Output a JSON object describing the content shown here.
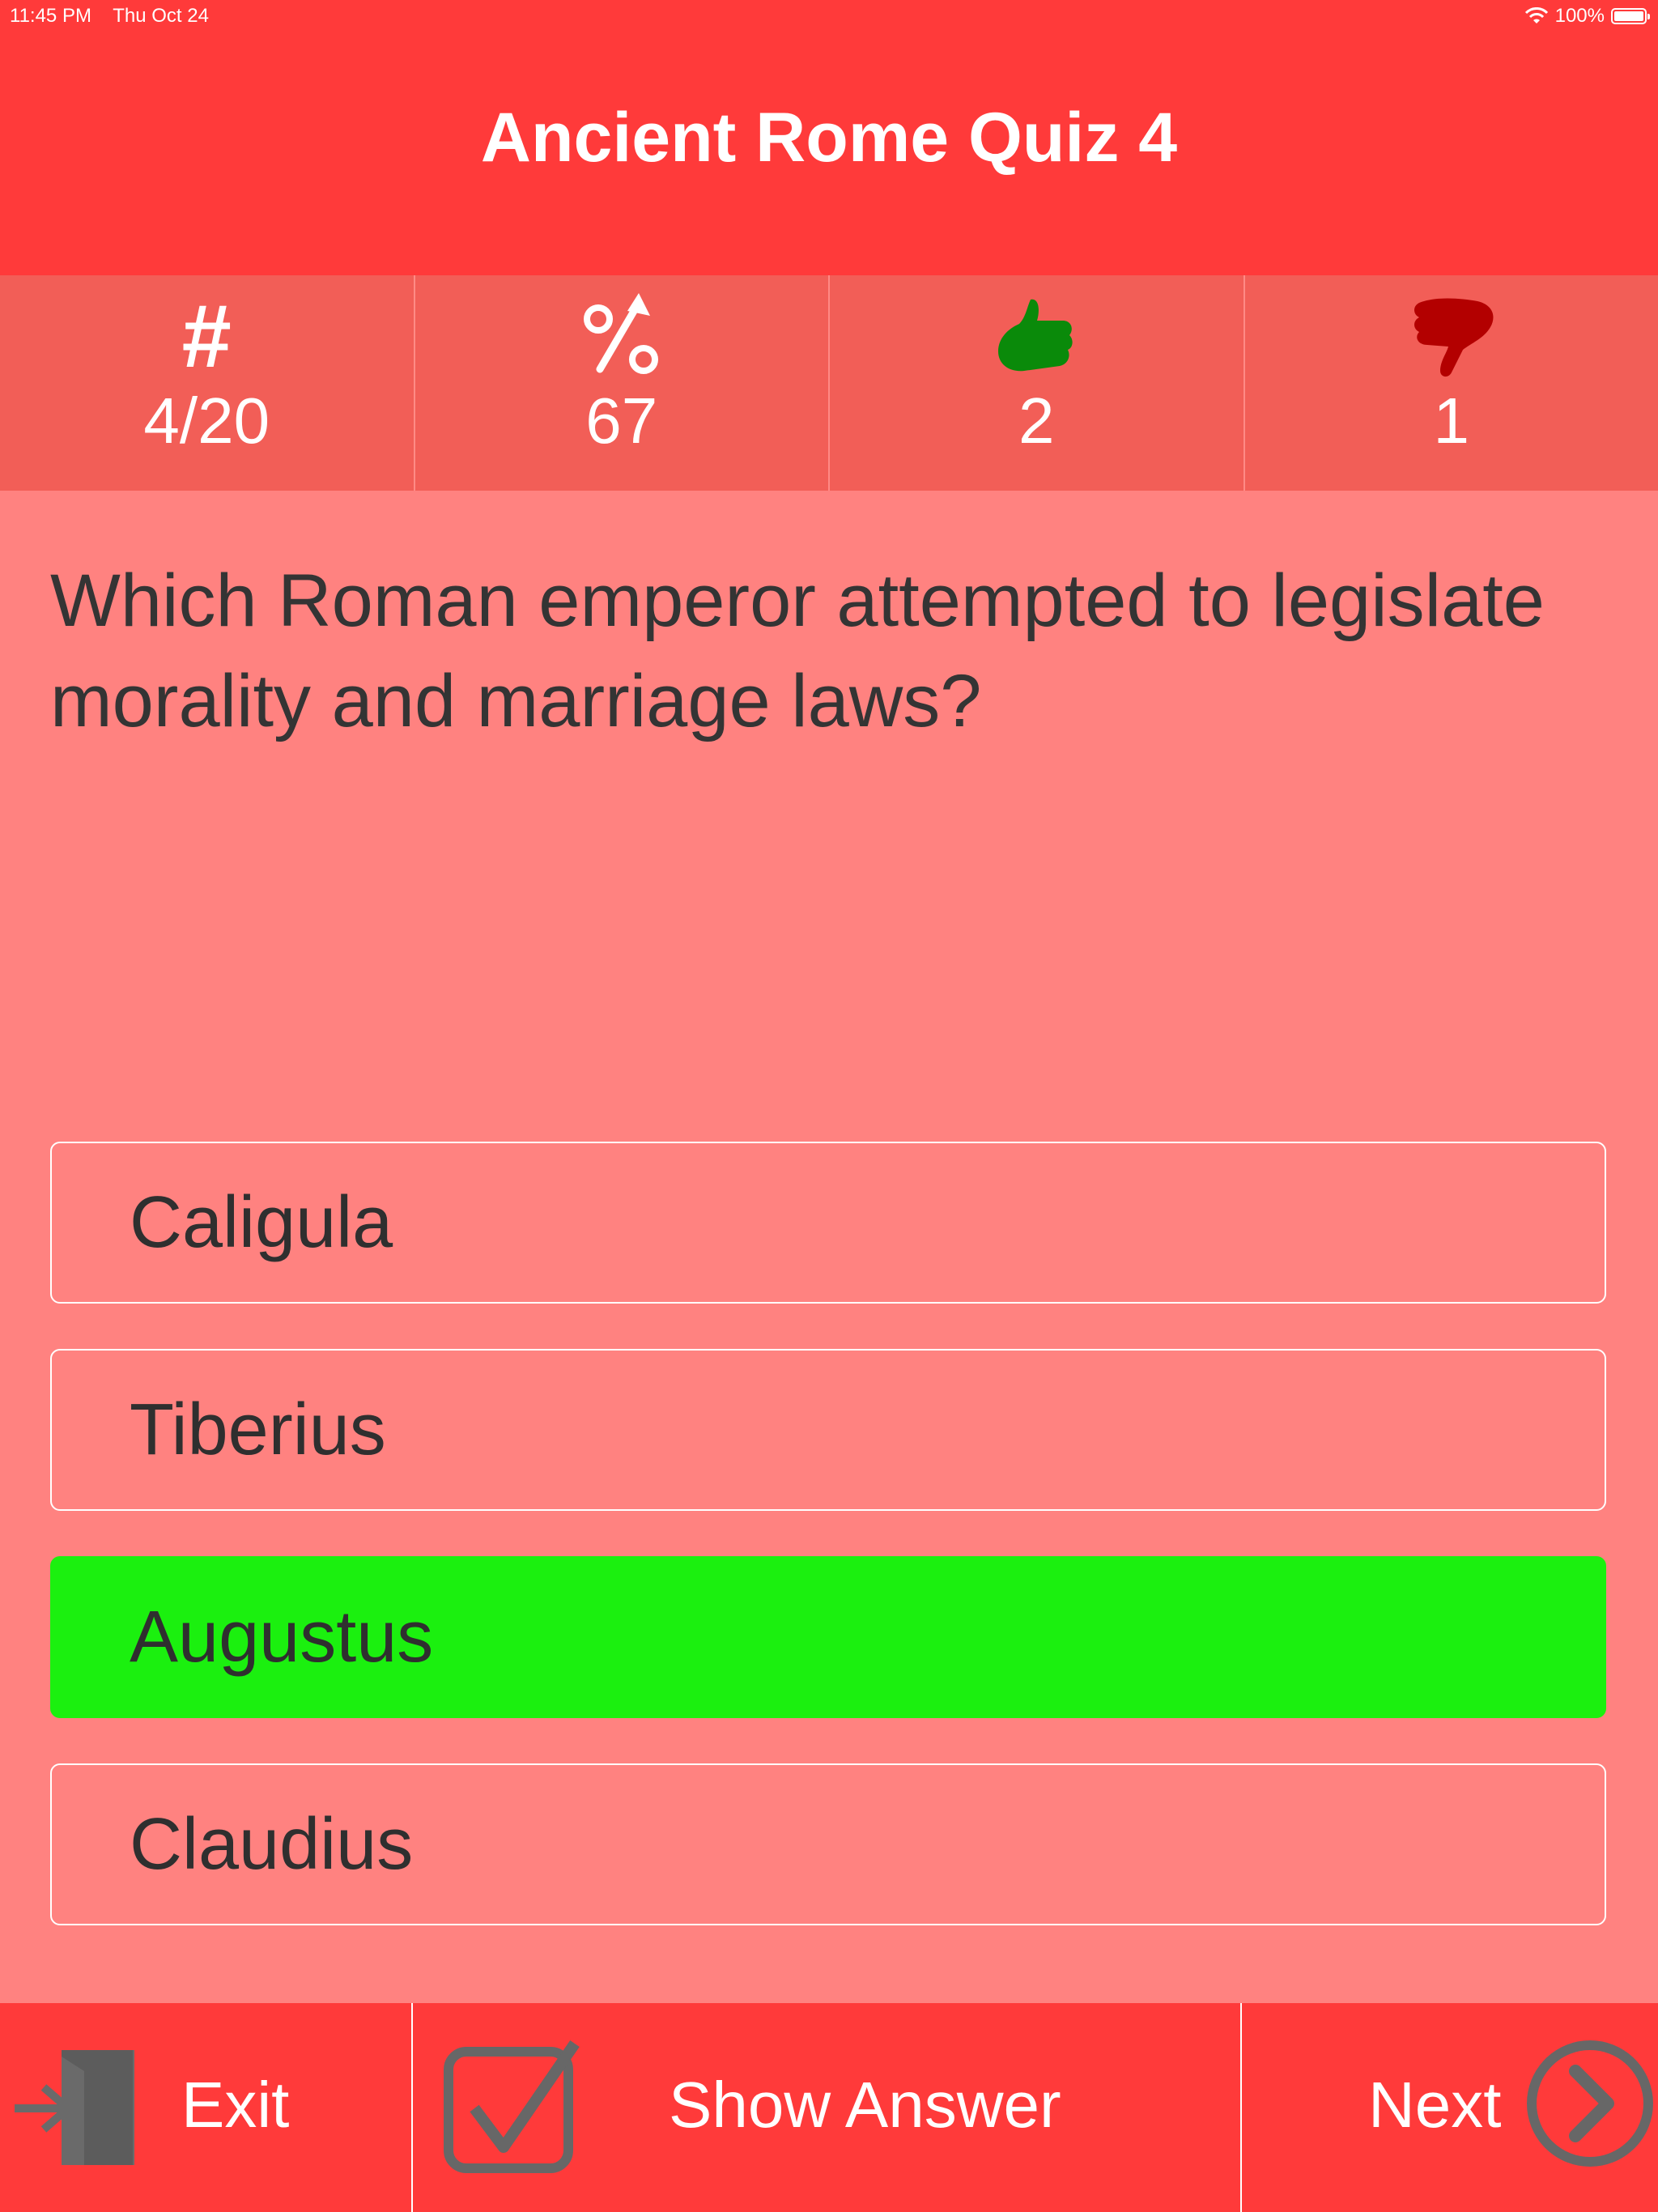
{
  "status_bar": {
    "time": "11:45 PM",
    "date": "Thu Oct 24",
    "battery": "100%"
  },
  "header": {
    "title": "Ancient Rome Quiz 4"
  },
  "stats": {
    "question_number": "4/20",
    "percent": "67",
    "correct": "2",
    "incorrect": "1"
  },
  "question": "Which Roman emperor attempted to legislate morality and marriage laws?",
  "answers": [
    "Caligula",
    "Tiberius",
    "Augustus",
    "Claudius"
  ],
  "toolbar": {
    "exit": "Exit",
    "show_answer": "Show Answer",
    "next": "Next"
  },
  "colors": {
    "header": "#ff3a3a",
    "background": "#ff8280",
    "stats_bar": "#f25e57",
    "correct_answer": "#1bf00f",
    "thumbs_up": "#0a8a0a",
    "thumbs_down": "#b30000"
  }
}
